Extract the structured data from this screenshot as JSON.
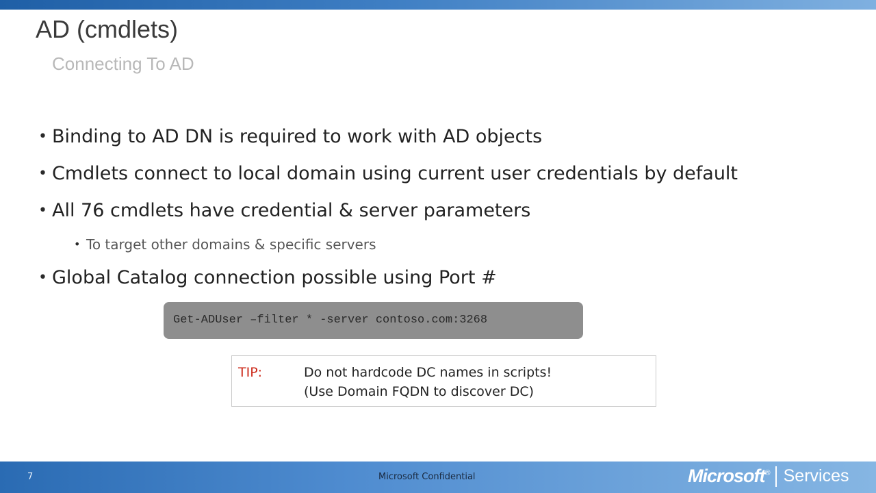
{
  "slide": {
    "title": "AD (cmdlets)",
    "subtitle": "Connecting To AD"
  },
  "bullets": [
    {
      "text": "Binding to AD DN is required to work with AD objects"
    },
    {
      "text": "Cmdlets connect to local domain using current user credentials by default"
    },
    {
      "text": "All 76 cmdlets have credential & server parameters"
    },
    {
      "text": "To target other domains & specific servers"
    },
    {
      "text": "Global Catalog connection possible using Port #"
    }
  ],
  "bullet_glyph": "•",
  "code": {
    "text": "Get-ADUser –filter * -server contoso.com:3268"
  },
  "tip": {
    "label": "TIP:",
    "line1": "Do not hardcode DC names in scripts!",
    "line2": "(Use Domain FQDN to discover DC)",
    "label_color": "#cc2a1a"
  },
  "footer": {
    "slide_number": "7",
    "confidential": "Microsoft Confidential",
    "logo_brand": "Microsoft",
    "logo_registered": "®",
    "logo_product": "Services"
  }
}
